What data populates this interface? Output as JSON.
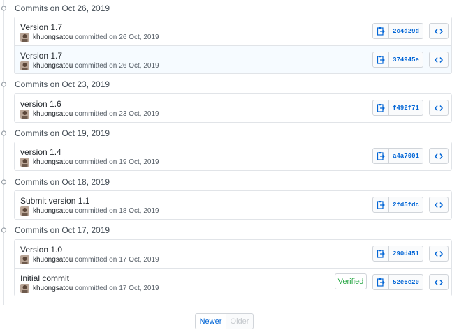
{
  "groups": [
    {
      "header": "Commits on Oct 26, 2019",
      "commits": [
        {
          "title": "Version 1.7",
          "author": "khuongsatou",
          "action": "committed on",
          "date": "26 Oct, 2019",
          "sha": "2c4d29d"
        },
        {
          "title": "Version 1.7",
          "author": "khuongsatou",
          "action": "committed on",
          "date": "26 Oct, 2019",
          "sha": "374945e"
        }
      ]
    },
    {
      "header": "Commits on Oct 23, 2019",
      "commits": [
        {
          "title": "version 1.6",
          "author": "khuongsatou",
          "action": "committed on",
          "date": "23 Oct, 2019",
          "sha": "f492f71"
        }
      ]
    },
    {
      "header": "Commits on Oct 19, 2019",
      "commits": [
        {
          "title": "version 1.4",
          "author": "khuongsatou",
          "action": "committed on",
          "date": "19 Oct, 2019",
          "sha": "a4a7001"
        }
      ]
    },
    {
      "header": "Commits on Oct 18, 2019",
      "commits": [
        {
          "title": "Submit version 1.1",
          "author": "khuongsatou",
          "action": "committed on",
          "date": "18 Oct, 2019",
          "sha": "2fd5fdc"
        }
      ]
    },
    {
      "header": "Commits on Oct 17, 2019",
      "commits": [
        {
          "title": "Version 1.0",
          "author": "khuongsatou",
          "action": "committed on",
          "date": "17 Oct, 2019",
          "sha": "290d451"
        },
        {
          "title": "Initial commit",
          "author": "khuongsatou",
          "action": "committed on",
          "date": "17 Oct, 2019",
          "sha": "52e6e20",
          "verified": "Verified"
        }
      ]
    }
  ],
  "pagination": {
    "newer": "Newer",
    "older": "Older"
  },
  "colors": {
    "link": "#0366d6",
    "verified": "#28a745",
    "border": "#e1e4e8"
  }
}
